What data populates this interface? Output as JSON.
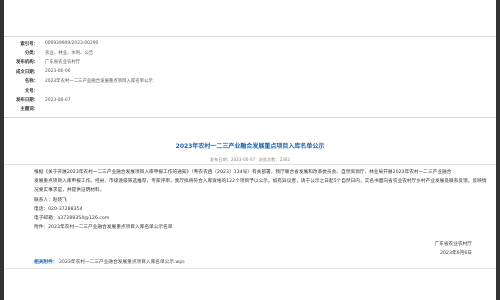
{
  "meta": [
    {
      "label": "索引号：",
      "value": "006939909/2023-00290"
    },
    {
      "label": "分类：",
      "value": "农业、林业、水利、公告"
    },
    {
      "label": "发布机构：",
      "value": "广东省农业农村厅"
    },
    {
      "label": "成文日期：",
      "value": "2023-06-06"
    },
    {
      "label": "名称：",
      "value": "2023年农村一二三产业融合发展重点项目入库名单公示"
    },
    {
      "label": "文号：",
      "value": ""
    },
    {
      "label": "发布日期：",
      "value": "2023-06-07"
    },
    {
      "label": "主题词：",
      "value": ""
    }
  ],
  "article": {
    "title": "2023年农村一二三产业融合发展重点项目入库名单公示",
    "date_label": "发布日期：2023-06-07",
    "views_label": "浏览次数：2302",
    "paragraph_lines": [
      "根据《关于开展2023年农村一二三产业融合发展项目入库申报工作的通知》（粤农农函〔2023〕134号）有关部署，我厅联合省发展和改革委员会、自然资源厅、林业局开展2023年农村一二三产业融合",
      "发展重点项目入库申报工作。经县、市级逐级筛选推荐，专家评审，我厅拟将符合入库资格的122个项目予以公示。如有异议者，请于公示之日起5个自然日内，实名书面向省农业农村厅乡村产业发展处联系反馈。反映情",
      "况要实事求是，并提供证明材料。"
    ],
    "contacts": [
      "联系人：赵晓飞",
      "电话：020-37288354",
      "电子邮箱：a37288354@126.com"
    ],
    "attachment_line": "附件：2023年农村一二三产业融合发展重点项目入库名单公示名单",
    "signature_org": "广东省农业农村厅",
    "signature_date": "2023年6月6日",
    "related_label": "相关附件：",
    "related_file": "2023年农村一二三产业融合发展重点项目入库名单公示.wps"
  }
}
